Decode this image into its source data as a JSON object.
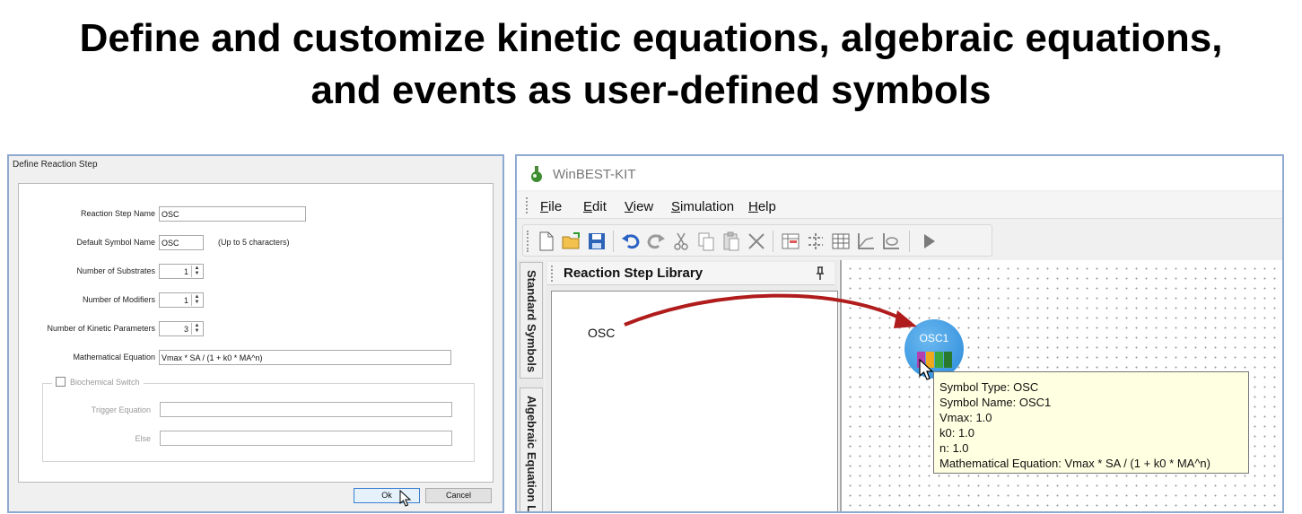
{
  "headline": {
    "line1": "Define and customize kinetic equations, algebraic equations,",
    "line2": "and events as user-defined symbols"
  },
  "dialog": {
    "title": "Define Reaction Step",
    "fields": {
      "reaction_step_name": {
        "label": "Reaction Step Name",
        "value": "OSC"
      },
      "default_symbol_name": {
        "label": "Default Symbol Name",
        "value": "OSC",
        "hint": "(Up to 5 characters)"
      },
      "num_substrates": {
        "label": "Number of Substrates",
        "value": "1"
      },
      "num_modifiers": {
        "label": "Number of Modifiers",
        "value": "1"
      },
      "num_kinetic_params": {
        "label": "Number of Kinetic Parameters",
        "value": "3"
      },
      "math_equation": {
        "label": "Mathematical Equation",
        "value": "Vmax * SA / (1 + k0 * MA^n)"
      }
    },
    "biochemical_switch": {
      "label": "Biochemical Switch",
      "checked": false,
      "trigger_label": "Trigger Equation",
      "else_label": "Else"
    },
    "ok_label": "Ok",
    "cancel_label": "Cancel"
  },
  "app": {
    "title": "WinBEST-KIT",
    "menus": [
      {
        "u": "F",
        "rest": "ile"
      },
      {
        "u": "E",
        "rest": "dit"
      },
      {
        "u": "V",
        "rest": "iew"
      },
      {
        "u": "S",
        "rest": "imulation"
      },
      {
        "u": "H",
        "rest": "elp"
      }
    ],
    "side_tabs": {
      "standard": "Standard Symbols",
      "algebraic": "Algebraic Equation L"
    },
    "library": {
      "title": "Reaction Step Library",
      "items": [
        "OSC"
      ]
    },
    "symbol": {
      "label": "OSC1"
    },
    "tooltip": {
      "type": "Symbol Type: OSC",
      "name": "Symbol Name: OSC1",
      "vmax": "Vmax: 1.0",
      "k0": "k0: 1.0",
      "n": "n: 1.0",
      "equation": "Mathematical Equation: Vmax * SA / (1 + k0 * MA^n)"
    },
    "colors": {
      "arrow": "#b01c1c",
      "symbol": "#3a97e0",
      "tooltip_bg": "#ffffe1"
    }
  }
}
